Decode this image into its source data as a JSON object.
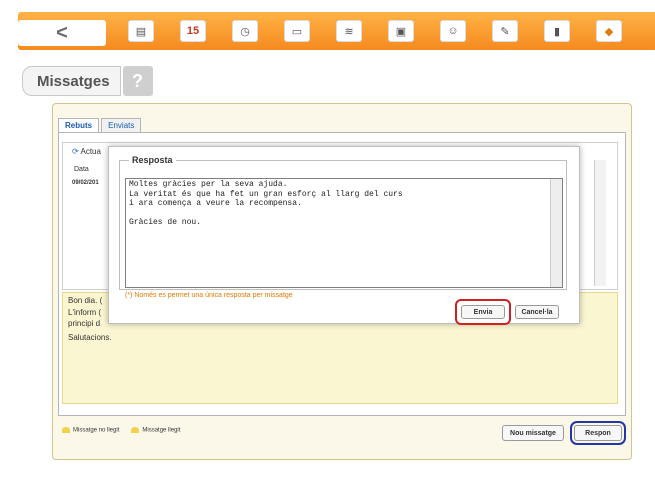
{
  "header": {
    "back_label": "<",
    "tools": [
      {
        "icon": "document-icon",
        "glyph": "▤"
      },
      {
        "icon": "calendar-icon",
        "glyph": "15"
      },
      {
        "icon": "clock-icon",
        "glyph": "◷"
      },
      {
        "icon": "note-icon",
        "glyph": "▭"
      },
      {
        "icon": "chart-icon",
        "glyph": "≋"
      },
      {
        "icon": "tablet-icon",
        "glyph": "▣"
      },
      {
        "icon": "user-icon",
        "glyph": "☺"
      },
      {
        "icon": "edit-icon",
        "glyph": "✎"
      },
      {
        "icon": "phone-icon",
        "glyph": "▮"
      },
      {
        "icon": "tag-icon",
        "glyph": "◆"
      }
    ],
    "title": "Missatges",
    "help_label": "?"
  },
  "tabs": [
    "Rebuts",
    "Enviats"
  ],
  "list": {
    "refresh_label": "Actua",
    "col_date": "Data",
    "row_date": "09/02/201"
  },
  "message": {
    "lines": [
      "Bon dia. (",
      "L'inform (",
      "principi d",
      "Salutacions."
    ]
  },
  "modal": {
    "title": "Resposta",
    "text": "Moltes gràcies per la seva ajuda.\nLa veritat és que ha fet un gran esforç al llarg del curs\ni ara comença a veure la recompensa.\n\nGràcies de nou.",
    "note": "(*) Només es permet una única resposta per missatge",
    "send_label": "Envia",
    "cancel_label": "Cancel·la"
  },
  "legend": {
    "unread": "Missatge no llegit",
    "read": "Missatge llegit"
  },
  "actions": {
    "new_message": "Nou missatge",
    "reply": "Respon"
  },
  "colors": {
    "accent_orange": "#f58a1f",
    "highlight_red": "#d02020",
    "highlight_blue": "#2435a8"
  }
}
